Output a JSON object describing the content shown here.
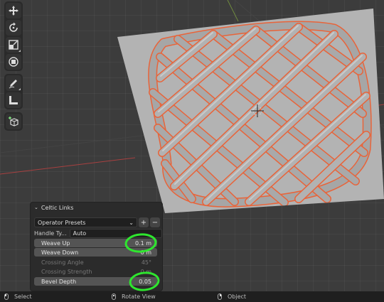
{
  "toolbar": {
    "tools": [
      {
        "name": "move-tool",
        "icon": "move-arrows-icon"
      },
      {
        "name": "rotate-tool",
        "icon": "rotate-icon"
      },
      {
        "name": "scale-tool",
        "icon": "scale-icon"
      },
      {
        "name": "transform-tool",
        "icon": "transform-icon"
      },
      {
        "name": "annotate-tool",
        "icon": "pencil-icon"
      },
      {
        "name": "measure-tool",
        "icon": "ruler-icon"
      },
      {
        "name": "add-cube-tool",
        "icon": "add-cube-icon"
      }
    ]
  },
  "panel": {
    "title": "Celtic Links",
    "presets_label": "Operator Presets",
    "presets_add": "+",
    "presets_remove": "−",
    "handle_label": "Handle Ty...",
    "handle_value": "Auto",
    "props": [
      {
        "label": "Weave Up",
        "value": "0.1 m",
        "state": "active"
      },
      {
        "label": "Weave Down",
        "value": "0 m",
        "state": "active"
      },
      {
        "label": "Crossing Angle",
        "value": "45°",
        "state": "dim"
      },
      {
        "label": "Crossing Strength",
        "value": "0 m",
        "state": "dim"
      },
      {
        "label": "Bevel Depth",
        "value": "0.05",
        "state": "active"
      }
    ]
  },
  "status_bar": {
    "select": "Select",
    "rotate_view": "Rotate View",
    "object": "Object"
  },
  "colors": {
    "plane": "#b3b3b3",
    "knot": "#a9a9a9",
    "knot_outline": "#e8643a",
    "highlight_circle": "#2ee62e",
    "x_axis": "#b04040"
  }
}
